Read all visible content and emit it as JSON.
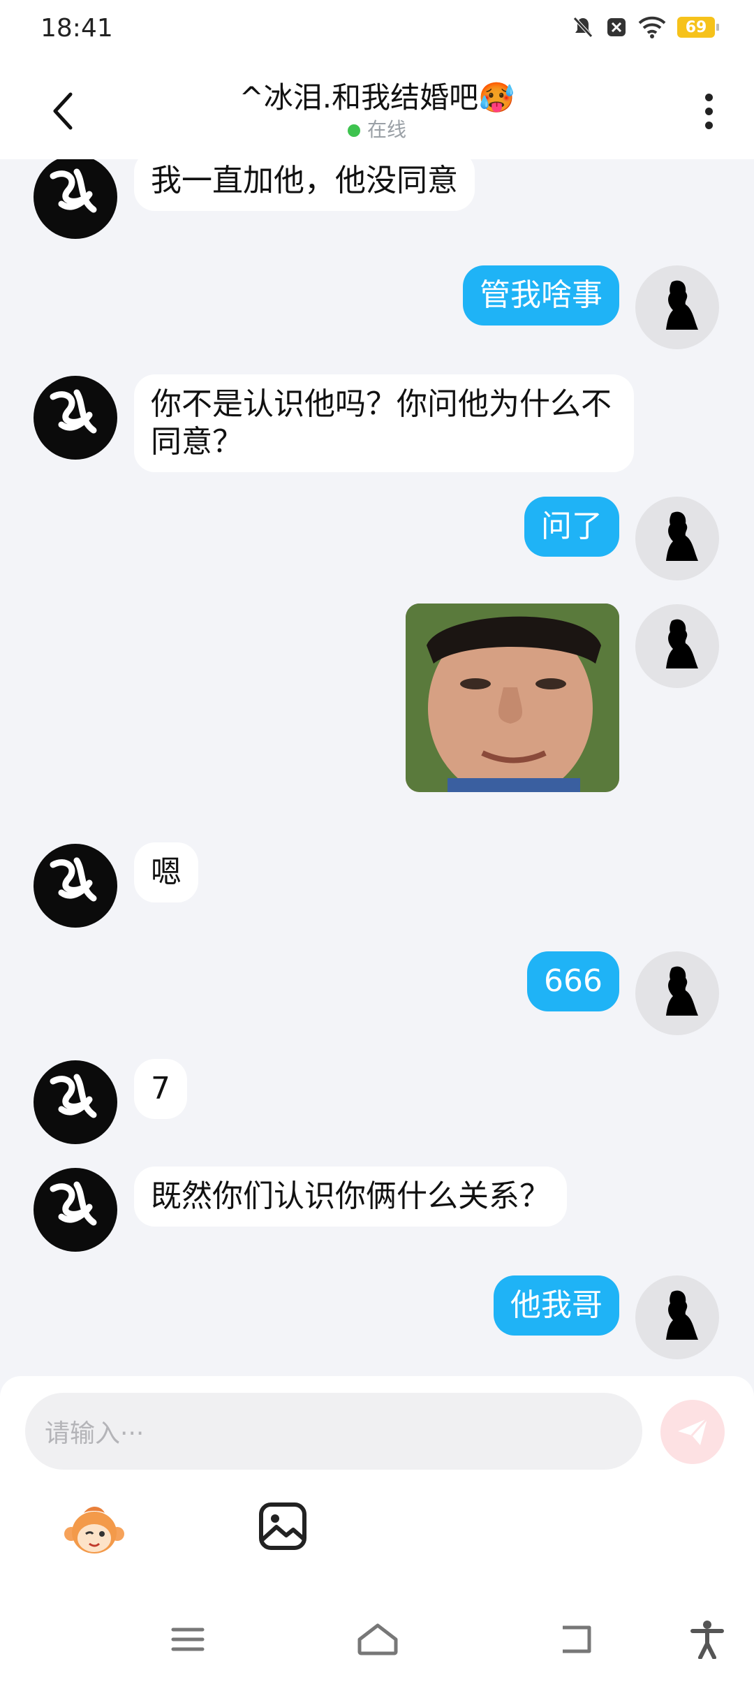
{
  "status_bar": {
    "time": "18:41",
    "battery": "69"
  },
  "header": {
    "title": "^冰泪.和我结婚吧🥵",
    "status": "在线"
  },
  "messages": [
    {
      "side": "left",
      "text": "我一直加他，他没同意"
    },
    {
      "side": "right",
      "text": "管我啥事"
    },
    {
      "side": "left",
      "text": "你不是认识他吗？你问他为什么不同意？"
    },
    {
      "side": "right",
      "text": "问了"
    },
    {
      "side": "right",
      "type": "image"
    },
    {
      "side": "left",
      "text": "嗯"
    },
    {
      "side": "right",
      "text": "666"
    },
    {
      "side": "left",
      "text": "7"
    },
    {
      "side": "left",
      "text": "既然你们认识你俩什么关系？"
    },
    {
      "side": "right",
      "text": "他我哥"
    }
  ],
  "composer": {
    "placeholder": "请输入···"
  },
  "icons": {
    "back": "chevron-left-icon",
    "more": "more-vertical-icon",
    "send": "paper-plane-icon",
    "emoji": "monkey-emoji-icon",
    "image": "image-icon",
    "nav": [
      "menu-icon",
      "home-icon",
      "back-icon",
      "accessibility-icon"
    ]
  },
  "colors": {
    "outgoing_bubble": "#1fb3f6",
    "incoming_bubble": "#ffffff",
    "chat_background": "#f3f4f8",
    "online": "#3ec34f",
    "battery": "#f6c21b"
  }
}
